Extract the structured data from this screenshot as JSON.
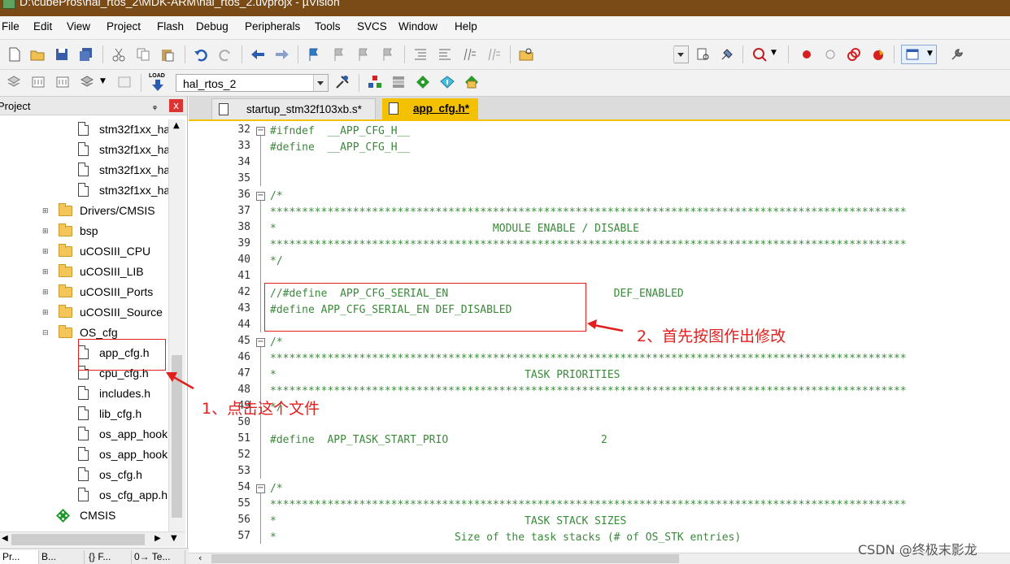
{
  "window": {
    "title": "D:\\cubePros\\hal_rtos_2\\MDK-ARM\\hal_rtos_2.uvprojx - µVision"
  },
  "menu": [
    "File",
    "Edit",
    "View",
    "Project",
    "Flash",
    "Debug",
    "Peripherals",
    "Tools",
    "SVCS",
    "Window",
    "Help"
  ],
  "toolbar": {
    "target_name": "hal_rtos_2",
    "load_label": "LOAD"
  },
  "project_panel": {
    "title": "Project",
    "pin": "ᵩ",
    "close": "x",
    "items": [
      {
        "label": "stm32f1xx_ha",
        "type": "file"
      },
      {
        "label": "stm32f1xx_ha",
        "type": "file"
      },
      {
        "label": "stm32f1xx_ha",
        "type": "file"
      },
      {
        "label": "stm32f1xx_ha",
        "type": "file"
      },
      {
        "label": "Drivers/CMSIS",
        "type": "folder"
      },
      {
        "label": "bsp",
        "type": "folder"
      },
      {
        "label": "uCOSIII_CPU",
        "type": "folder"
      },
      {
        "label": "uCOSIII_LIB",
        "type": "folder"
      },
      {
        "label": "uCOSIII_Ports",
        "type": "folder"
      },
      {
        "label": "uCOSIII_Source",
        "type": "folder"
      },
      {
        "label": "OS_cfg",
        "type": "folder-open"
      },
      {
        "label": "app_cfg.h",
        "type": "file"
      },
      {
        "label": "cpu_cfg.h",
        "type": "file"
      },
      {
        "label": "includes.h",
        "type": "file"
      },
      {
        "label": "lib_cfg.h",
        "type": "file"
      },
      {
        "label": "os_app_hook",
        "type": "file"
      },
      {
        "label": "os_app_hook",
        "type": "file"
      },
      {
        "label": "os_cfg.h",
        "type": "file"
      },
      {
        "label": "os_cfg_app.h",
        "type": "file"
      },
      {
        "label": "CMSIS",
        "type": "component"
      }
    ],
    "bottom_tabs": [
      "Pr...",
      "B...",
      "{} F...",
      "0→ Te..."
    ]
  },
  "editor": {
    "tabs": [
      {
        "label": "startup_stm32f103xb.s*",
        "active": false
      },
      {
        "label": "app_cfg.h*",
        "active": true
      }
    ],
    "lines": [
      {
        "num": "32",
        "text": "#ifndef  __APP_CFG_H__",
        "fold": "open"
      },
      {
        "num": "33",
        "text": "#define  __APP_CFG_H__",
        "fold": ""
      },
      {
        "num": "34",
        "text": "",
        "fold": ""
      },
      {
        "num": "35",
        "text": "",
        "fold": ""
      },
      {
        "num": "36",
        "text": "/*",
        "fold": "open"
      },
      {
        "num": "37",
        "text": "****************************************************************************************************",
        "fold": ""
      },
      {
        "num": "38",
        "text": "*                                  MODULE ENABLE / DISABLE",
        "fold": ""
      },
      {
        "num": "39",
        "text": "****************************************************************************************************",
        "fold": ""
      },
      {
        "num": "40",
        "text": "*/",
        "fold": ""
      },
      {
        "num": "41",
        "text": "",
        "fold": ""
      },
      {
        "num": "42",
        "text": "//#define  APP_CFG_SERIAL_EN                          DEF_ENABLED",
        "fold": ""
      },
      {
        "num": "43",
        "text": "#define APP_CFG_SERIAL_EN DEF_DISABLED",
        "fold": ""
      },
      {
        "num": "44",
        "text": "",
        "fold": ""
      },
      {
        "num": "45",
        "text": "/*",
        "fold": "open"
      },
      {
        "num": "46",
        "text": "****************************************************************************************************",
        "fold": ""
      },
      {
        "num": "47",
        "text": "*                                       TASK PRIORITIES",
        "fold": ""
      },
      {
        "num": "48",
        "text": "****************************************************************************************************",
        "fold": ""
      },
      {
        "num": "49",
        "text": "*/",
        "fold": ""
      },
      {
        "num": "50",
        "text": "",
        "fold": ""
      },
      {
        "num": "51",
        "text": "#define  APP_TASK_START_PRIO                        2",
        "fold": ""
      },
      {
        "num": "52",
        "text": "",
        "fold": ""
      },
      {
        "num": "53",
        "text": "",
        "fold": ""
      },
      {
        "num": "54",
        "text": "/*",
        "fold": "open"
      },
      {
        "num": "55",
        "text": "****************************************************************************************************",
        "fold": ""
      },
      {
        "num": "56",
        "text": "*                                       TASK STACK SIZES",
        "fold": ""
      },
      {
        "num": "57",
        "text": "*                            Size of the task stacks (# of OS_STK entries)",
        "fold": ""
      }
    ]
  },
  "annotations": {
    "step1": "1、点击这个文件",
    "step2": "2、首先按图作出修改"
  },
  "watermark": "CSDN @终极末影龙",
  "colors": {
    "annotation": "#e21f1f",
    "code_text": "#3a8a3a",
    "active_tab": "#f3c100",
    "title_bar": "#7a4a17"
  }
}
